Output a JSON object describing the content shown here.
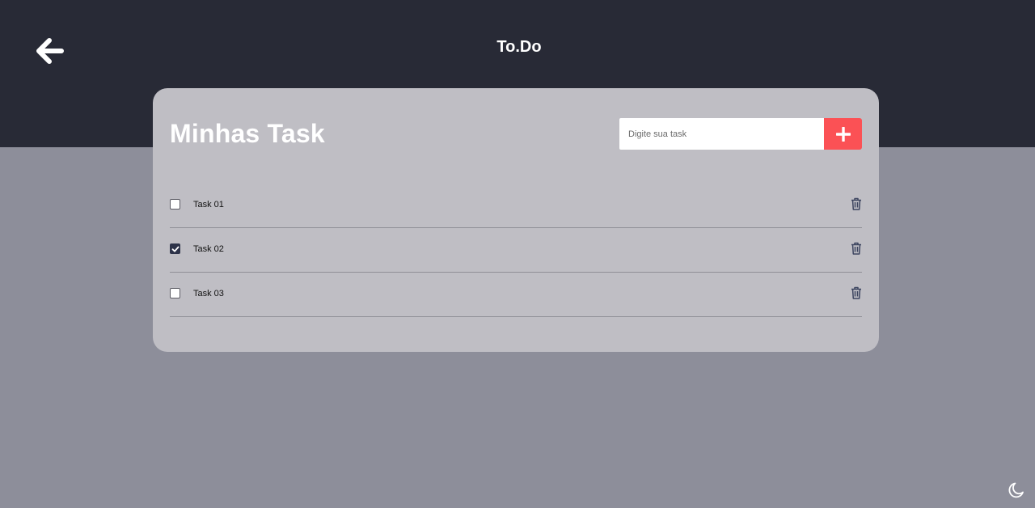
{
  "header": {
    "title": "To.Do",
    "back_icon": "arrow-left-icon"
  },
  "card": {
    "title": "Minhas Task",
    "input": {
      "placeholder": "Digite sua task",
      "value": ""
    },
    "add_icon": "plus-icon"
  },
  "tasks": [
    {
      "label": "Task 01",
      "checked": false
    },
    {
      "label": "Task 02",
      "checked": true
    },
    {
      "label": "Task 03",
      "checked": false
    }
  ],
  "theme_toggle_icon": "moon-icon",
  "colors": {
    "header_bg": "#282a36",
    "page_bg": "#8d8e9a",
    "card_bg": "#bfbec4",
    "accent": "#fb5155",
    "checkbox_checked": "#2d3349",
    "trash_icon": "#3d4560"
  }
}
